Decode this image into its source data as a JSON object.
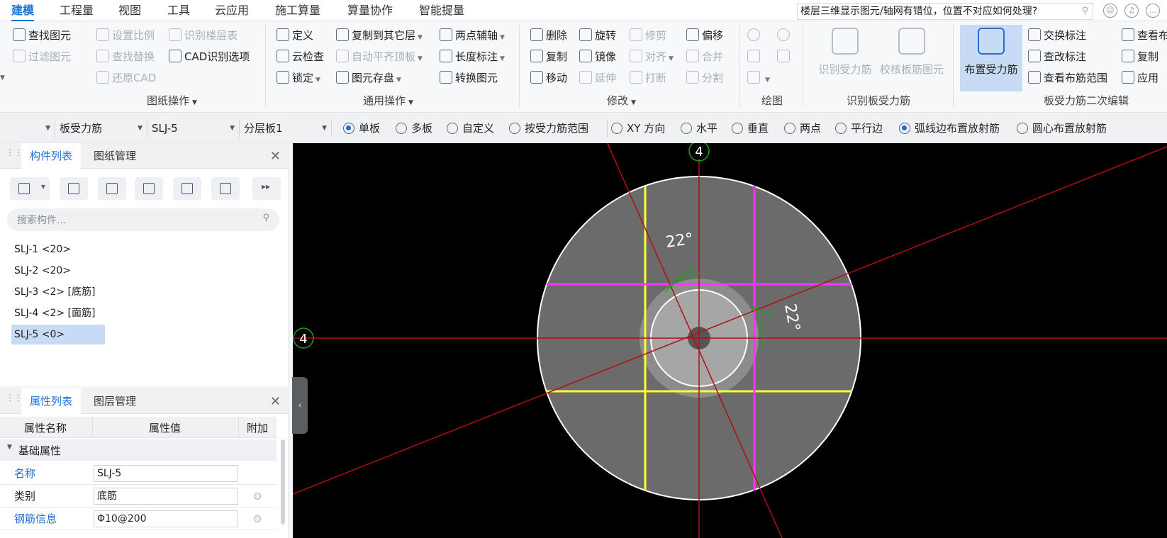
{
  "menu": {
    "tabs": [
      "建模",
      "工程量",
      "视图",
      "工具",
      "云应用",
      "施工算量",
      "算量协作",
      "智能提量"
    ],
    "active": "建模"
  },
  "help_search": {
    "text": "楼层三维显示图元/轴网有错位，位置不对应如何处理?"
  },
  "ribbon": {
    "drawing_ops": {
      "label": "图纸操作",
      "items": [
        "查找图元",
        "过滤图元",
        "设置比例",
        "查找替换",
        "还原CAD",
        "识别楼层表",
        "CAD识别选项"
      ]
    },
    "general_ops": {
      "label": "通用操作",
      "items": [
        "定义",
        "云检查",
        "锁定",
        "复制到其它层",
        "自动平齐顶板",
        "图元存盘",
        "两点辅轴",
        "长度标注",
        "转换图元"
      ]
    },
    "modify": {
      "label": "修改",
      "items": [
        "删除",
        "复制",
        "移动",
        "旋转",
        "镜像",
        "延伸",
        "修剪",
        "对齐",
        "打断",
        "偏移",
        "合并",
        "分割"
      ]
    },
    "draw": {
      "label": "绘图"
    },
    "identify": {
      "label": "识别板受力筋",
      "items": [
        "识别受力筋",
        "校核板筋图元"
      ]
    },
    "edit2": {
      "label": "板受力筋二次编辑",
      "items": [
        "布置受力筋",
        "交换标注",
        "查改标注",
        "查看布筋范围",
        "查看布",
        "复制",
        "应用"
      ]
    }
  },
  "toolbar": {
    "combos": [
      "",
      "板受力筋",
      "SLJ-5",
      "分层板1"
    ],
    "radios1": [
      {
        "label": "单板",
        "checked": true
      },
      {
        "label": "多板",
        "checked": false
      },
      {
        "label": "自定义",
        "checked": false
      },
      {
        "label": "按受力筋范围",
        "checked": false
      }
    ],
    "radios2": [
      {
        "label": "XY 方向",
        "checked": false
      },
      {
        "label": "水平",
        "checked": false
      },
      {
        "label": "垂直",
        "checked": false
      },
      {
        "label": "两点",
        "checked": false
      },
      {
        "label": "平行边",
        "checked": false
      },
      {
        "label": "弧线边布置放射筋",
        "checked": true
      },
      {
        "label": "圆心布置放射筋",
        "checked": false
      }
    ]
  },
  "component_panel": {
    "tabs": [
      "构件列表",
      "图纸管理"
    ],
    "search_placeholder": "搜索构件...",
    "items": [
      "SLJ-1 <20>",
      "SLJ-2 <20>",
      "SLJ-3 <2> [底筋]",
      "SLJ-4 <2> [面筋]",
      "SLJ-5 <0>"
    ],
    "selected": "SLJ-5 <0>"
  },
  "property_panel": {
    "tabs": [
      "属性列表",
      "图层管理"
    ],
    "headers": [
      "属性名称",
      "属性值",
      "附加"
    ],
    "group": "基础属性",
    "rows": [
      {
        "name": "名称",
        "value": "SLJ-5"
      },
      {
        "name": "类别",
        "value": "底筋"
      },
      {
        "name": "钢筋信息",
        "value": "Φ10@200"
      }
    ]
  },
  "canvas": {
    "axis_labels": [
      "4",
      "4"
    ],
    "angle_labels": [
      "22°",
      "22°"
    ],
    "colors": {
      "background": "#000000",
      "slab": "#6b6b6b",
      "axis": "#b01010",
      "rebar_yellow": "#ffff33",
      "rebar_magenta": "#ff33ff",
      "arc": "#1fa01f"
    }
  }
}
